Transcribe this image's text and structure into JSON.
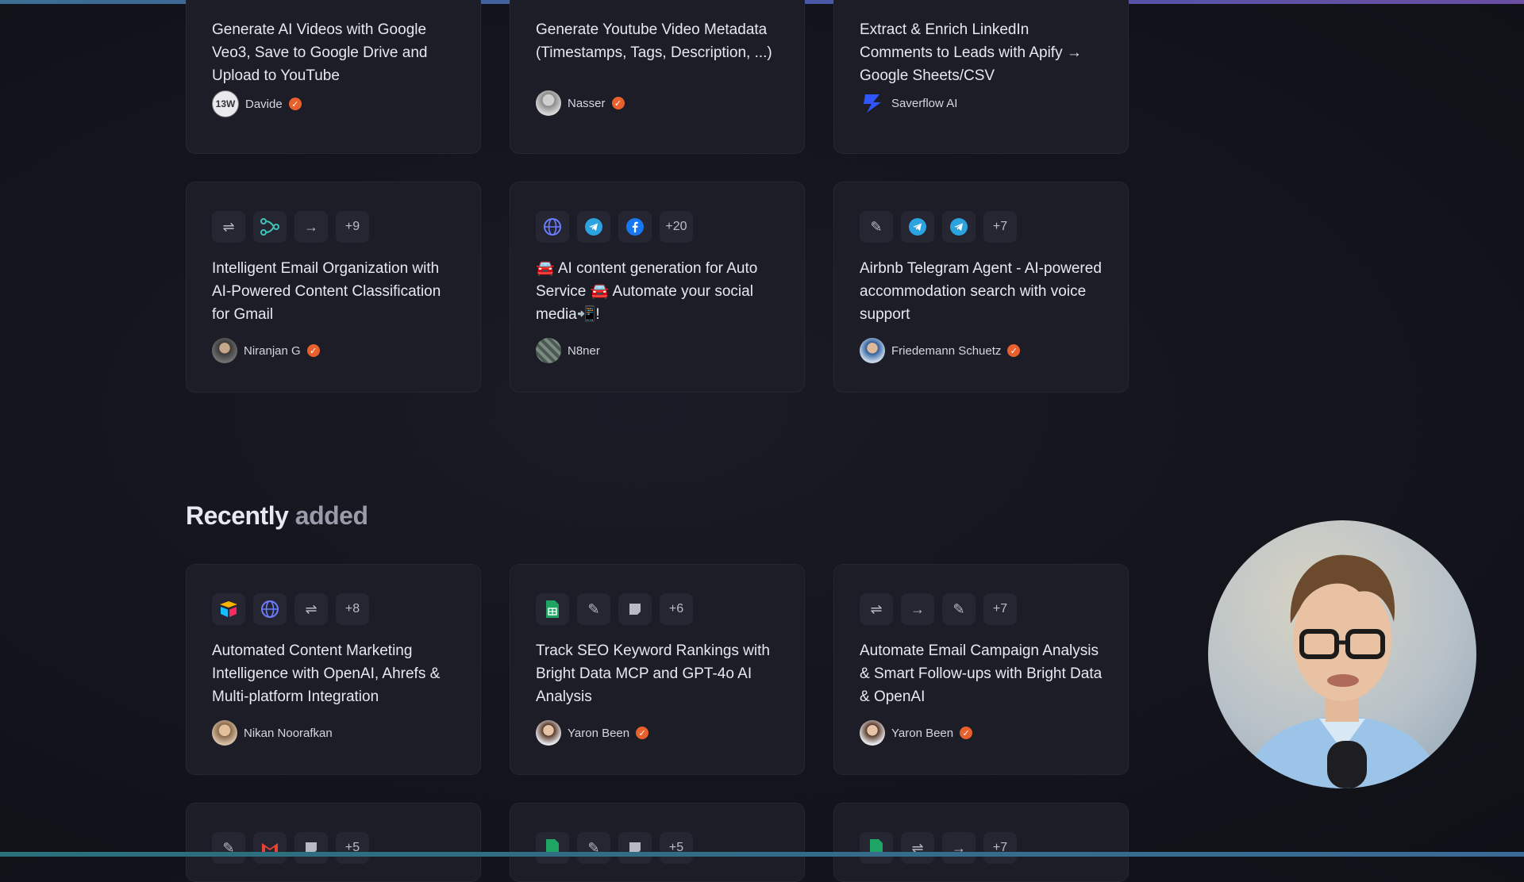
{
  "top_cards": [
    {
      "title": "Generate AI Videos with Google Veo3, Save to Google Drive and Upload to YouTube",
      "author": "Davide",
      "verified": true
    },
    {
      "title": "Generate Youtube Video Metadata (Timestamps, Tags, Description, ...)",
      "author": "Nasser",
      "verified": true
    },
    {
      "title": "Extract & Enrich LinkedIn Comments to Leads with Apify → Google Sheets/CSV",
      "author": "Saverflow AI",
      "verified": false
    }
  ],
  "row2_cards": [
    {
      "more": "+9",
      "title": "Intelligent Email Organization with AI-Powered Content Classification for Gmail",
      "author": "Niranjan G",
      "verified": true
    },
    {
      "more": "+20",
      "title": "🚘 AI content generation for Auto Service 🚘 Automate your social media📲!",
      "author": "N8ner",
      "verified": false
    },
    {
      "more": "+7",
      "title": "Airbnb Telegram Agent - AI-powered accommodation search with voice support",
      "author": "Friedemann Schuetz",
      "verified": true
    }
  ],
  "recent": {
    "title_part1": "Recently",
    "title_part2": "added",
    "cards": [
      {
        "more": "+8",
        "title": "Automated Content Marketing Intelligence with OpenAI, Ahrefs & Multi-platform Integration",
        "author": "Nikan Noorafkan",
        "verified": false
      },
      {
        "more": "+6",
        "title": "Track SEO Keyword Rankings with Bright Data MCP and GPT-4o AI Analysis",
        "author": "Yaron Been",
        "verified": true
      },
      {
        "more": "+7",
        "title": "Automate Email Campaign Analysis & Smart Follow-ups with Bright Data & OpenAI",
        "author": "Yaron Been",
        "verified": true
      }
    ],
    "partial_cards": [
      {
        "more": "+5"
      },
      {
        "more": "+5"
      },
      {
        "more": "+7"
      }
    ]
  },
  "icons": {
    "check": "✓",
    "filter": "⇌",
    "arrow": "→",
    "pencil": "✎"
  }
}
